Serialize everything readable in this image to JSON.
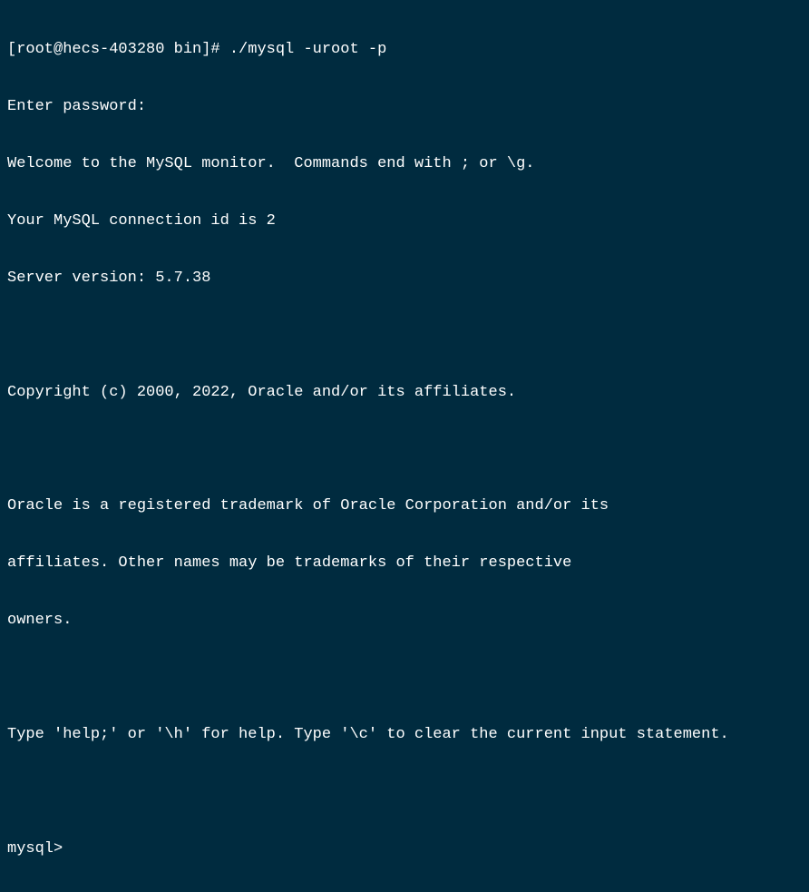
{
  "terminal": {
    "prompt_line": "[root@hecs-403280 bin]# ./mysql -uroot -p",
    "password_prompt": "Enter password:",
    "welcome": "Welcome to the MySQL monitor.  Commands end with ; or \\g.",
    "connection_id": "Your MySQL connection id is 2",
    "server_version": "Server version: 5.7.38",
    "blank1": "",
    "copyright": "Copyright (c) 2000, 2022, Oracle and/or its affiliates.",
    "blank2": "",
    "trademark1": "Oracle is a registered trademark of Oracle Corporation and/or its",
    "trademark2": "affiliates. Other names may be trademarks of their respective",
    "trademark3": "owners.",
    "blank3": "",
    "help": "Type 'help;' or '\\h' for help. Type '\\c' to clear the current input statement.",
    "blank4": "",
    "mysql_prompt": "mysql>"
  }
}
